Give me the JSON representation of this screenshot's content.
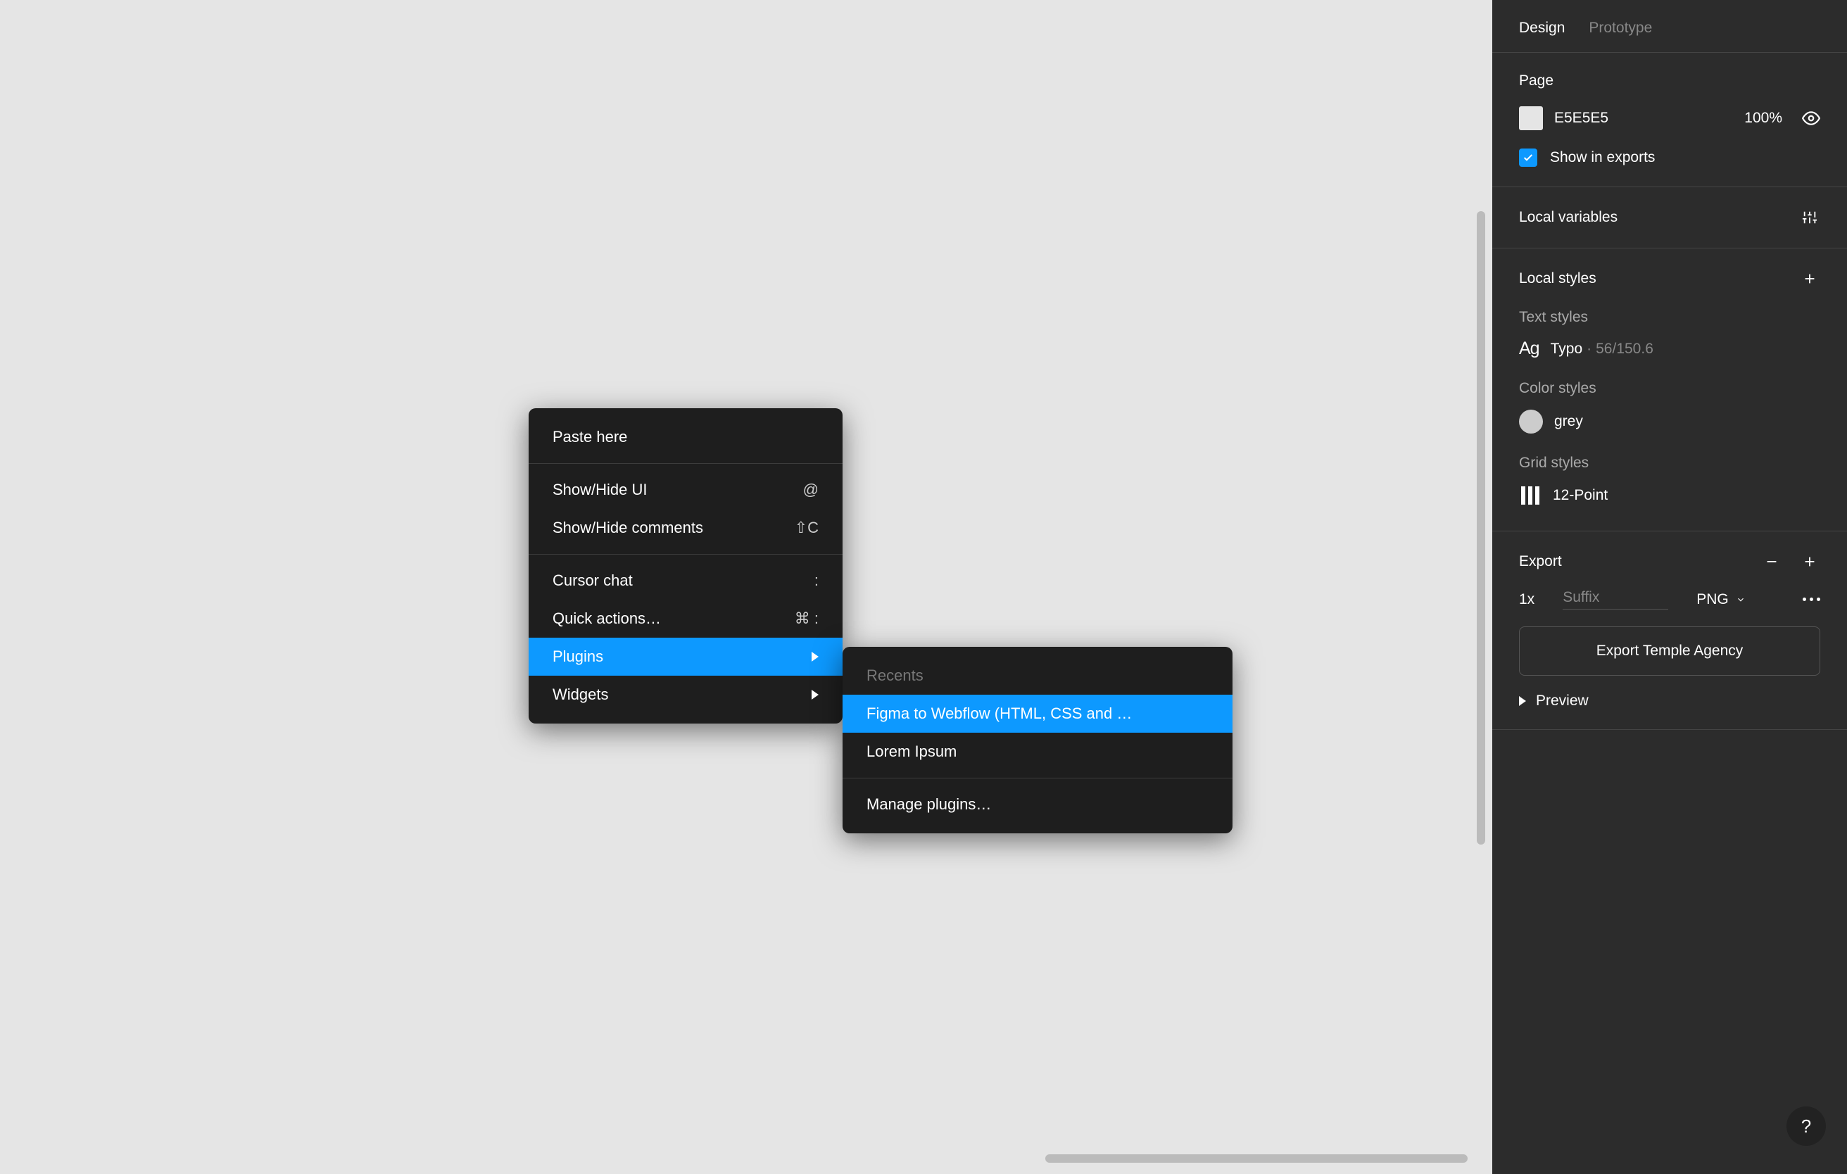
{
  "tabs": {
    "design": "Design",
    "prototype": "Prototype"
  },
  "page": {
    "title": "Page",
    "color": "E5E5E5",
    "opacity": "100%",
    "show_exports_label": "Show in exports"
  },
  "local_vars": {
    "title": "Local variables"
  },
  "local_styles": {
    "title": "Local styles",
    "text_title": "Text styles",
    "ag": "Ag",
    "typo_name": "Typo",
    "typo_dot": "·",
    "typo_meta": "56/150.6",
    "color_title": "Color styles",
    "color_name": "grey",
    "grid_title": "Grid styles",
    "grid_name": "12-Point"
  },
  "export": {
    "title": "Export",
    "scale": "1x",
    "suffix_placeholder": "Suffix",
    "format": "PNG",
    "button": "Export Temple Agency",
    "preview": "Preview"
  },
  "help": {
    "label": "?"
  },
  "context_menu": {
    "paste_here": "Paste here",
    "show_hide_ui": "Show/Hide UI",
    "show_hide_ui_short": "@",
    "show_hide_comments": "Show/Hide comments",
    "show_hide_comments_short": "⇧C",
    "cursor_chat": "Cursor chat",
    "cursor_chat_short": ":",
    "quick_actions": "Quick actions…",
    "quick_actions_short": "⌘ :",
    "plugins": "Plugins",
    "widgets": "Widgets"
  },
  "plugins_submenu": {
    "recents": "Recents",
    "figma_webflow": "Figma to Webflow (HTML, CSS and …",
    "lorem": "Lorem Ipsum",
    "manage": "Manage plugins…"
  }
}
